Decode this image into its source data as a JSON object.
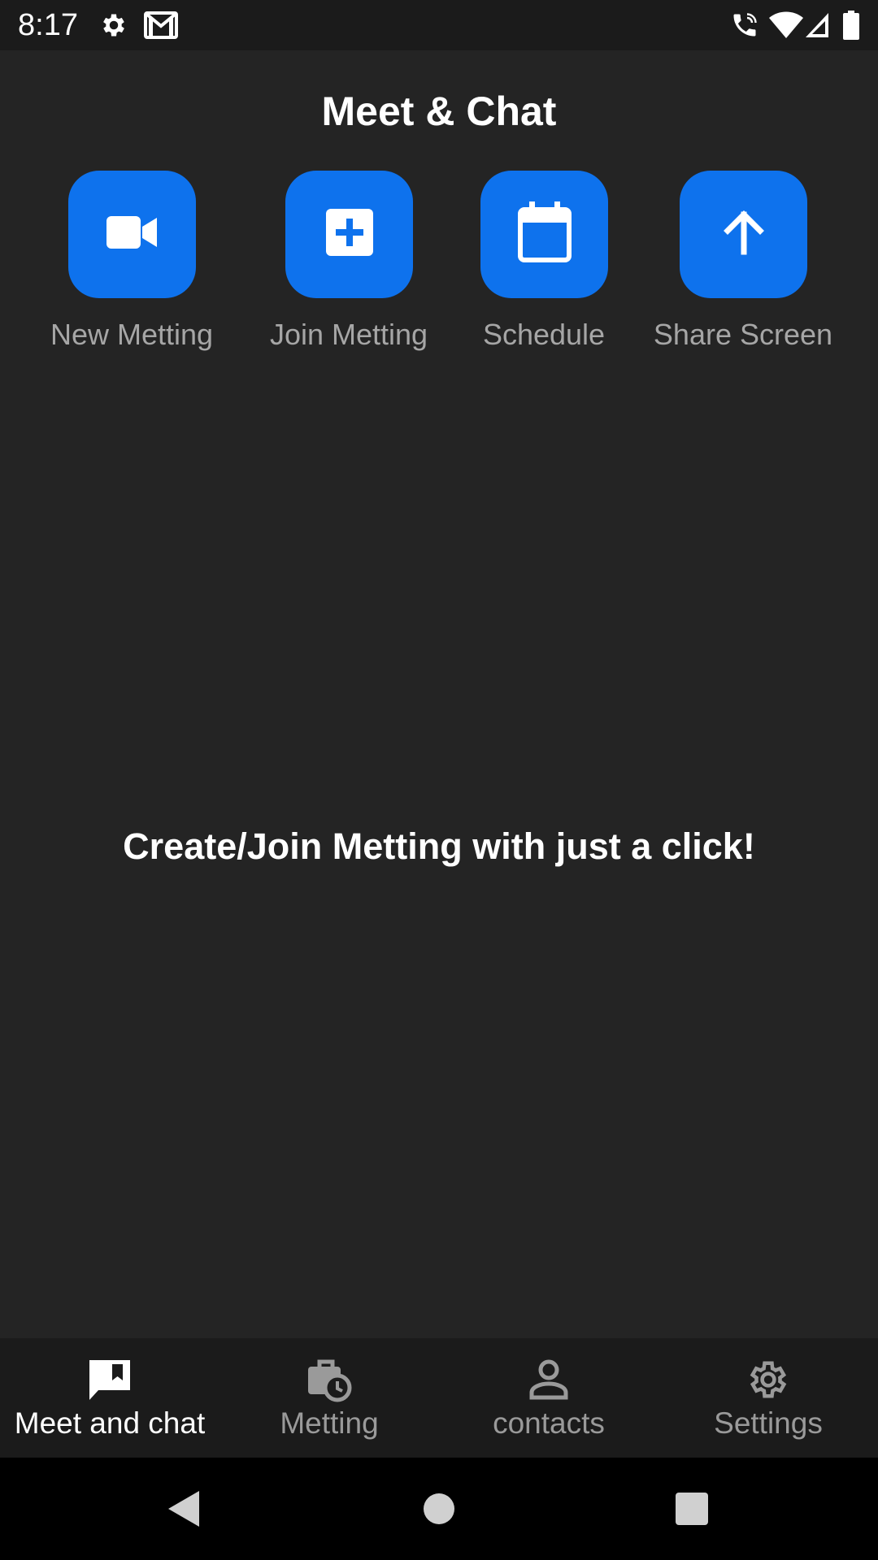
{
  "status_bar": {
    "time": "8:17",
    "icons": [
      "gear-icon",
      "gmail-icon",
      "wifi-calling-icon",
      "wifi-icon",
      "signal-icon",
      "battery-icon"
    ]
  },
  "header": {
    "title": "Meet & Chat"
  },
  "actions": [
    {
      "label": "New Metting",
      "icon": "video-camera-icon"
    },
    {
      "label": "Join Metting",
      "icon": "plus-box-icon"
    },
    {
      "label": "Schedule",
      "icon": "calendar-icon"
    },
    {
      "label": "Share Screen",
      "icon": "arrow-up-icon"
    }
  ],
  "main": {
    "message": "Create/Join Metting with just a click!"
  },
  "bottom_nav": {
    "items": [
      {
        "label": "Meet and chat",
        "icon": "chat-bookmark-icon",
        "active": true
      },
      {
        "label": "Metting",
        "icon": "briefcase-clock-icon",
        "active": false
      },
      {
        "label": "contacts",
        "icon": "person-icon",
        "active": false
      },
      {
        "label": "Settings",
        "icon": "gear-icon",
        "active": false
      }
    ]
  },
  "system_nav": {
    "buttons": [
      "back-icon",
      "home-icon",
      "recents-icon"
    ]
  },
  "colors": {
    "background": "#242424",
    "bars": "#1b1b1b",
    "accent": "#0e72ed",
    "label_gray": "#a6a6a6"
  }
}
